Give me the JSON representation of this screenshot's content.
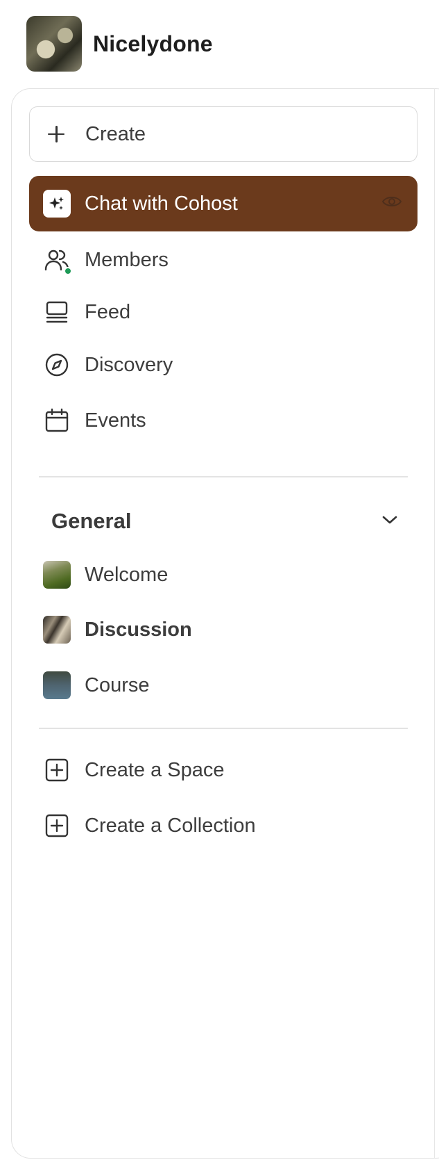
{
  "header": {
    "community_name": "Nicelydone"
  },
  "create_button": {
    "label": "Create"
  },
  "nav": {
    "items": [
      {
        "label": "Chat with Cohost",
        "icon": "sparkle-icon",
        "active": true
      },
      {
        "label": "Members",
        "icon": "users-icon",
        "presence": "online"
      },
      {
        "label": "Feed",
        "icon": "feed-icon"
      },
      {
        "label": "Discovery",
        "icon": "compass-icon"
      },
      {
        "label": "Events",
        "icon": "calendar-icon"
      }
    ]
  },
  "sections": [
    {
      "title": "General",
      "expanded": true,
      "spaces": [
        {
          "label": "Welcome",
          "bold": false
        },
        {
          "label": "Discussion",
          "bold": true
        },
        {
          "label": "Course",
          "bold": false
        }
      ]
    }
  ],
  "actions": [
    {
      "label": "Create a Space",
      "icon": "plus-square-icon"
    },
    {
      "label": "Create a Collection",
      "icon": "plus-square-icon"
    }
  ],
  "colors": {
    "active_bg": "#6b3a1c",
    "presence": "#1e9a57",
    "text": "#3a3a3a"
  }
}
